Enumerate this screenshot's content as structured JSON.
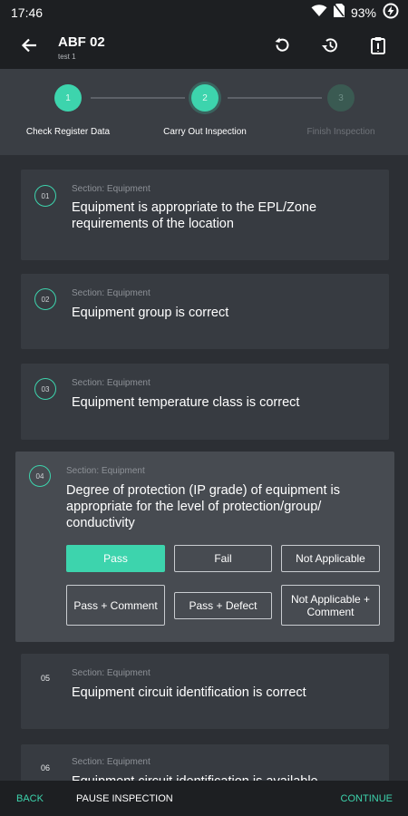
{
  "status_bar": {
    "time": "17:46",
    "battery": "93%"
  },
  "app_bar": {
    "title": "ABF 02",
    "subtitle": "test 1"
  },
  "stepper": [
    {
      "number": "1",
      "label": "Check Register Data",
      "state": "done"
    },
    {
      "number": "2",
      "label": "Carry Out Inspection",
      "state": "active"
    },
    {
      "number": "3",
      "label": "Finish Inspection",
      "state": "pending"
    }
  ],
  "questions": [
    {
      "number": "01",
      "section": "Section: Equipment",
      "text": "Equipment is appropriate to the EPL/Zone requirements of the location"
    },
    {
      "number": "02",
      "section": "Section: Equipment",
      "text": "Equipment group is correct"
    },
    {
      "number": "03",
      "section": "Section: Equipment",
      "text": "Equipment temperature class is correct"
    },
    {
      "number": "04",
      "section": "Section: Equipment",
      "text": "Degree of protection (IP grade) of equipment is appropriate for the level of protection/group/ conductivity"
    },
    {
      "number": "05",
      "section": "Section: Equipment",
      "text": "Equipment circuit identification is correct"
    },
    {
      "number": "06",
      "section": "Section: Equipment",
      "text": "Equipment circuit identification is available"
    }
  ],
  "options": {
    "pass": "Pass",
    "fail": "Fail",
    "not_applicable": "Not Applicable",
    "pass_comment": "Pass + Comment",
    "pass_defect": "Pass + Defect",
    "na_comment": "Not Applicable + Comment",
    "selected": "Pass"
  },
  "bottom_bar": {
    "back": "BACK",
    "pause": "PAUSE INSPECTION",
    "continue": "CONTINUE"
  },
  "colors": {
    "accent": "#3dd4ad",
    "background": "#2c2f34",
    "card": "#373b41",
    "bar": "#1d1f22"
  },
  "icons": [
    "wifi-icon",
    "no-sim-icon",
    "battery-icon",
    "arrow-back-icon",
    "undo-icon",
    "history-icon",
    "clipboard-icon"
  ]
}
